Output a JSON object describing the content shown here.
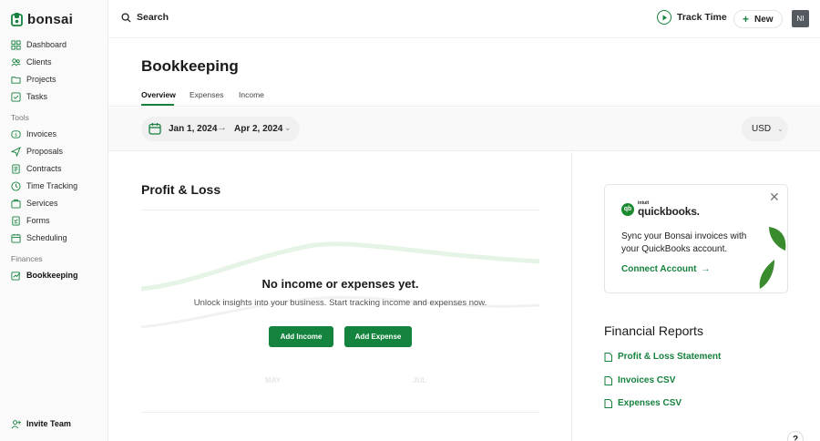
{
  "brand": {
    "name": "bonsai"
  },
  "sidebar": {
    "main_items": [
      {
        "label": "Dashboard",
        "icon": "dashboard-icon"
      },
      {
        "label": "Clients",
        "icon": "users-icon"
      },
      {
        "label": "Projects",
        "icon": "folder-icon"
      },
      {
        "label": "Tasks",
        "icon": "checkbox-icon"
      }
    ],
    "tools_label": "Tools",
    "tool_items": [
      {
        "label": "Invoices",
        "icon": "invoice-icon"
      },
      {
        "label": "Proposals",
        "icon": "send-icon"
      },
      {
        "label": "Contracts",
        "icon": "contract-icon"
      },
      {
        "label": "Time Tracking",
        "icon": "clock-icon"
      },
      {
        "label": "Services",
        "icon": "services-icon"
      },
      {
        "label": "Forms",
        "icon": "form-icon"
      },
      {
        "label": "Scheduling",
        "icon": "calendar-icon"
      }
    ],
    "finances_label": "Finances",
    "finance_items": [
      {
        "label": "Bookkeeping",
        "icon": "bookkeeping-icon",
        "active": true
      }
    ],
    "invite": "Invite Team"
  },
  "topbar": {
    "search": "Search",
    "track": "Track Time",
    "new": "New",
    "avatar": "NI"
  },
  "page": {
    "title": "Bookkeeping",
    "tabs": [
      {
        "label": "Overview",
        "active": true
      },
      {
        "label": "Expenses"
      },
      {
        "label": "Income"
      }
    ]
  },
  "filters": {
    "date_from": "Jan 1, 2024",
    "date_arrow": "→",
    "date_to": "Apr 2, 2024",
    "currency": "USD"
  },
  "pnl": {
    "title": "Profit & Loss",
    "empty_title": "No income or expenses yet.",
    "empty_sub": "Unlock insights into your business. Start tracking income and expenses now.",
    "add_income": "Add Income",
    "add_expense": "Add Expense",
    "faded_labels": [
      "MAY",
      "JUL"
    ]
  },
  "quickbooks": {
    "intuit": "intuit",
    "brand": "quickbooks.",
    "text": "Sync your Bonsai invoices with your QuickBooks account.",
    "connect": "Connect Account"
  },
  "reports": {
    "title": "Financial Reports",
    "links": [
      {
        "label": "Profit & Loss Statement"
      },
      {
        "label": "Invoices CSV"
      },
      {
        "label": "Expenses CSV"
      }
    ]
  },
  "colors": {
    "accent": "#16823e",
    "sidebar_bg": "#fafafa"
  }
}
